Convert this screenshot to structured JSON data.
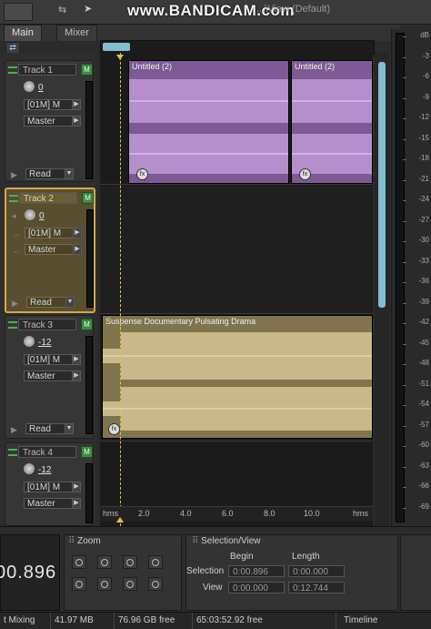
{
  "overlay": {
    "watermark": "www.BANDICAM.com"
  },
  "window": {
    "title_fragment": "...\\View (Default)"
  },
  "tabs": [
    {
      "label": "Main"
    },
    {
      "label": "Mixer"
    }
  ],
  "tracks": [
    {
      "name": "Track 1",
      "volume": "0",
      "input": "[01M] M",
      "output": "Master",
      "mode": "Read",
      "mute": "M",
      "selected": false
    },
    {
      "name": "Track 2",
      "volume": "0",
      "input": "[01M] M",
      "output": "Master",
      "mode": "Read",
      "mute": "M",
      "selected": true
    },
    {
      "name": "Track 3",
      "volume": "-12",
      "input": "[01M] M",
      "output": "Master",
      "mode": "Read",
      "mute": "M",
      "selected": false
    },
    {
      "name": "Track 4",
      "volume": "-12",
      "input": "[01M] M",
      "output": "Master",
      "mode": "",
      "mute": "M",
      "selected": false
    }
  ],
  "clips": [
    {
      "title": "Untitled (2)",
      "color": "#7d5a94"
    },
    {
      "title": "Untitled (2)",
      "color": "#7d5a94"
    },
    {
      "title": "Suspense Documentary Pulsating Drama",
      "color": "#7f744c"
    }
  ],
  "ruler": {
    "unit_left": "hms",
    "unit_right": "hms",
    "ticks": [
      "2.0",
      "4.0",
      "6.0",
      "8.0",
      "10.0"
    ]
  },
  "db_scale": [
    "dB",
    "-3",
    "-6",
    "-9",
    "-12",
    "-15",
    "-18",
    "-21",
    "-24",
    "-27",
    "-30",
    "-33",
    "-36",
    "-39",
    "-42",
    "-45",
    "-48",
    "-51",
    "-54",
    "-57",
    "-60",
    "-63",
    "-66",
    "-69"
  ],
  "time_display": {
    "value": "00.896"
  },
  "zoom": {
    "title": "Zoom"
  },
  "selection_view": {
    "title": "Selection/View",
    "col_begin": "Begin",
    "col_length": "Length",
    "row_selection": "Selection",
    "row_view": "View",
    "selection_begin": "0:00.896",
    "selection_length": "0:00.000",
    "view_begin": "0:00.000",
    "view_length": "0:12.744"
  },
  "status": {
    "mode": "t Mixing",
    "memory": "41.97 MB",
    "disk_free": "76.96 GB free",
    "time_free": "65:03:52.92 free",
    "view": "Timeline"
  },
  "colors": {
    "accent": "#7fbfcf",
    "selected_track": "#d4a84a",
    "clip_purple": "#7d5a94",
    "clip_gold": "#7f744c"
  }
}
